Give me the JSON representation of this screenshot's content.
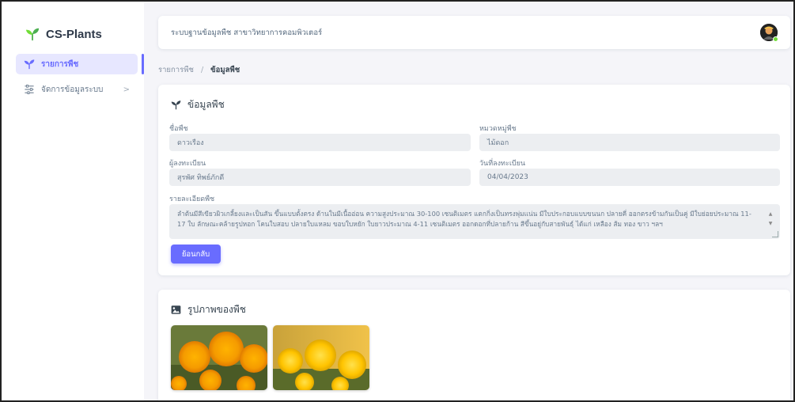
{
  "brand": {
    "name": "CS-Plants"
  },
  "sidebar": {
    "items": [
      {
        "label": "รายการพืช",
        "active": true
      },
      {
        "label": "จัดการข้อมูลระบบ",
        "chevron": ">"
      }
    ]
  },
  "navbar": {
    "title": "ระบบฐานข้อมูลพืช สาขาวิทยาการคอมพิวเตอร์"
  },
  "breadcrumb": {
    "parent": "รายการพืช",
    "separator": "/",
    "current": "ข้อมูลพืช"
  },
  "plant_card": {
    "title": "ข้อมูลพืช",
    "fields": {
      "name_label": "ชื่อพืช",
      "name_value": "ดาวเรือง",
      "category_label": "หมวดหมู่พืช",
      "category_value": "ไม้ดอก",
      "registrar_label": "ผู้ลงทะเบียน",
      "registrar_value": "สุรพัศ ทิพย์ภักดี",
      "date_label": "วันที่ลงทะเบียน",
      "date_value": "04/04/2023",
      "detail_label": "รายละเอียดพืช",
      "detail_value": "ลำต้นมีสีเขียวผิวเกลี้ยงและเป็นสัน ขึ้นแบบตั้งตรง ด้านในมีเนื้ออ่อน ความสูงประมาณ 30-100 เซนติเมตร แตกกิ่งเป็นทรงพุ่มแน่น มีใบประกอบแบบขนนก ปลายคี่ ออกตรงข้ามกันเป็นคู่ มีใบย่อยประมาณ 11-17 ใบ ลักษณะคล้ายรูปหอก โคนใบสอบ ปลายใบแหลม ขอบใบหยัก ใบยาวประมาณ 4-11 เซนติเมตร ออกดอกที่ปลายก้าน สีขึ้นอยู่กับสายพันธุ์ ได้แก่ เหลือง ส้ม ทอง ขาว ฯลฯ"
    },
    "back_button": "ย้อนกลับ"
  },
  "images_card": {
    "title": "รูปภาพของพืช"
  },
  "colors": {
    "accent": "#696cff",
    "active_bg": "#e7e7ff",
    "logo": "#71dd37"
  }
}
